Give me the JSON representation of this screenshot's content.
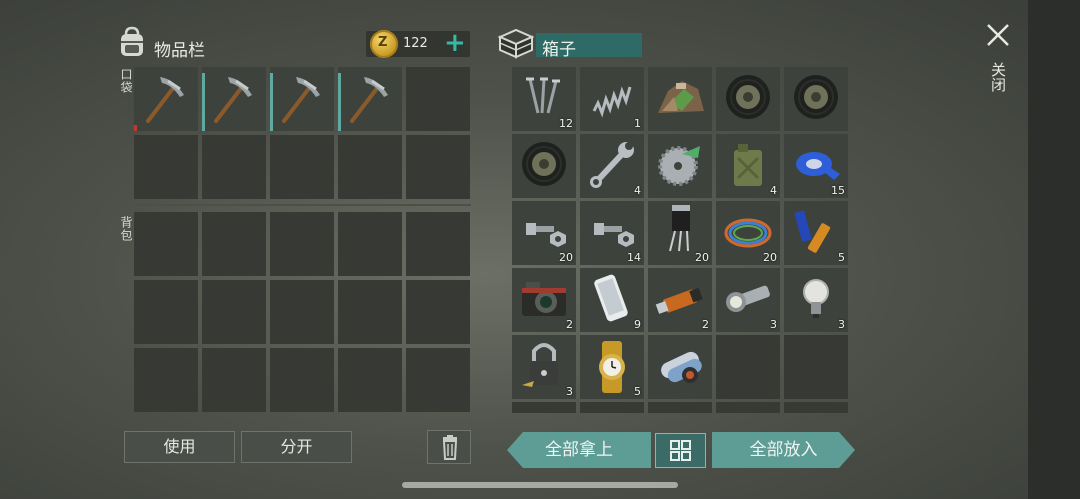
{
  "inventory": {
    "title": "物品栏",
    "coin_value": "122",
    "pocket_label": "口袋",
    "backpack_label": "背包",
    "pocket_items": [
      {
        "name": "pickaxe",
        "qty": ""
      },
      {
        "name": "pickaxe",
        "qty": ""
      },
      {
        "name": "pickaxe",
        "qty": ""
      },
      {
        "name": "pickaxe",
        "qty": ""
      }
    ]
  },
  "box": {
    "title": "箱子",
    "items": [
      {
        "name": "nails",
        "qty": "12"
      },
      {
        "name": "spring",
        "qty": "1"
      },
      {
        "name": "scrap-pile",
        "qty": ""
      },
      {
        "name": "tire",
        "qty": ""
      },
      {
        "name": "tire",
        "qty": ""
      },
      {
        "name": "tire",
        "qty": ""
      },
      {
        "name": "wrench",
        "qty": "4"
      },
      {
        "name": "saw-blade",
        "qty": ""
      },
      {
        "name": "jerrycan",
        "qty": "4"
      },
      {
        "name": "duct-tape",
        "qty": "15"
      },
      {
        "name": "bolt-nut",
        "qty": "20"
      },
      {
        "name": "bolt-nut",
        "qty": "14"
      },
      {
        "name": "transistor",
        "qty": "20"
      },
      {
        "name": "wires",
        "qty": "20"
      },
      {
        "name": "batteries",
        "qty": "5"
      },
      {
        "name": "camera",
        "qty": "2"
      },
      {
        "name": "smartphone",
        "qty": "9"
      },
      {
        "name": "usb-drive",
        "qty": "2"
      },
      {
        "name": "flashlight",
        "qty": "3"
      },
      {
        "name": "light-bulb",
        "qty": "3"
      },
      {
        "name": "padlock",
        "qty": "3"
      },
      {
        "name": "wristwatch",
        "qty": "5"
      },
      {
        "name": "maps-bundle",
        "qty": ""
      }
    ]
  },
  "buttons": {
    "use": "使用",
    "split": "分开",
    "take_all": "全部拿上",
    "put_all": "全部放入"
  },
  "close_label": "关闭",
  "colors": {
    "accent": "#37b8a3",
    "teal_button": "#5e9c96",
    "title_bar": "#2e6b66"
  }
}
